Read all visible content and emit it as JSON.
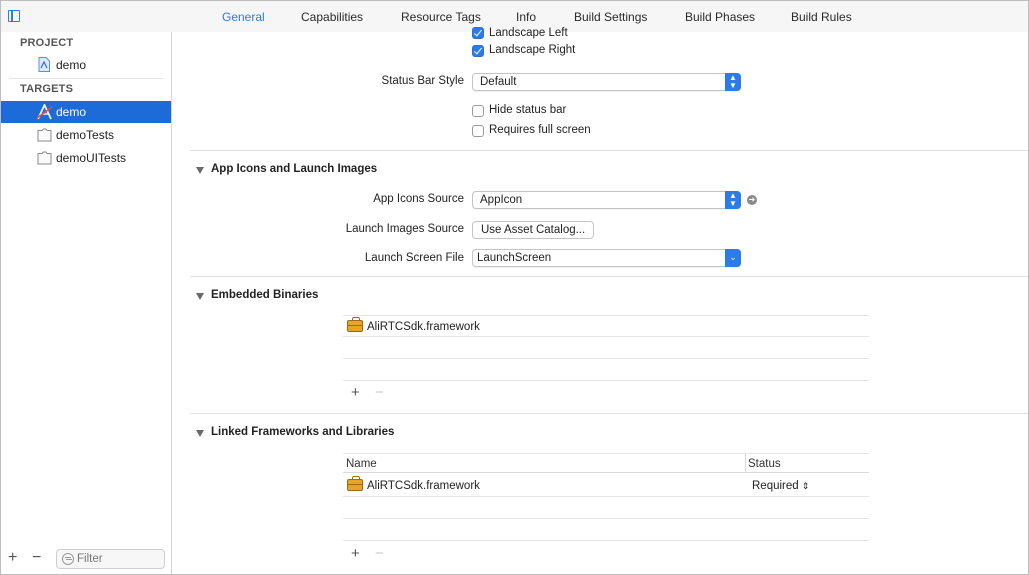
{
  "tabs": [
    "General",
    "Capabilities",
    "Resource Tags",
    "Info",
    "Build Settings",
    "Build Phases",
    "Build Rules"
  ],
  "sidebar": {
    "project_header": "PROJECT",
    "project_item": "demo",
    "targets_header": "TARGETS",
    "targets": [
      "demo",
      "demoTests",
      "demoUITests"
    ],
    "filter_placeholder": "Filter",
    "add": "+",
    "remove": "−"
  },
  "deployment": {
    "landscape_left": "Landscape Left",
    "landscape_right": "Landscape Right",
    "status_bar_style_label": "Status Bar Style",
    "status_bar_style_value": "Default",
    "hide_status_bar": "Hide status bar",
    "requires_full_screen": "Requires full screen"
  },
  "app_icons": {
    "title": "App Icons and Launch Images",
    "icons_source_label": "App Icons Source",
    "icons_source_value": "AppIcon",
    "launch_images_label": "Launch Images Source",
    "launch_images_button": "Use Asset Catalog...",
    "launch_screen_label": "Launch Screen File",
    "launch_screen_value": "LaunchScreen"
  },
  "embedded": {
    "title": "Embedded Binaries",
    "items": [
      "AliRTCSdk.framework"
    ],
    "add": "+",
    "remove": "−"
  },
  "linked": {
    "title": "Linked Frameworks and Libraries",
    "col_name": "Name",
    "col_status": "Status",
    "items": [
      {
        "name": "AliRTCSdk.framework",
        "status": "Required"
      }
    ],
    "add": "+",
    "remove": "−"
  },
  "colors": {
    "accent": "#2d7be8",
    "selection": "#1d6bd9",
    "framework_icon": "#e8a423"
  }
}
